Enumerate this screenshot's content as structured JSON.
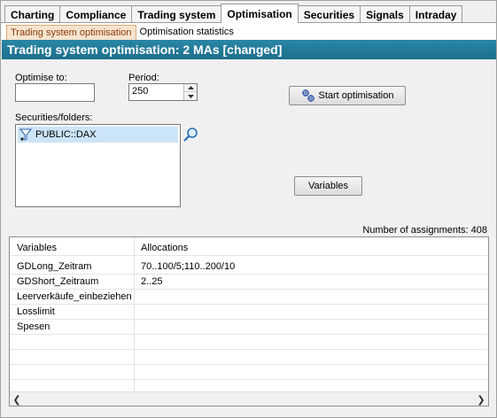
{
  "main_tabs": [
    "Charting",
    "Compliance",
    "Trading system",
    "Optimisation",
    "Securities",
    "Signals",
    "Intraday"
  ],
  "active_main_tab": "Optimisation",
  "sub_tabs": [
    "Trading system optimisation",
    "Optimisation statistics"
  ],
  "active_sub_tab": "Trading system optimisation",
  "title": "Trading system optimisation: 2 MAs [changed]",
  "form": {
    "optimise_to_label": "Optimise to:",
    "optimise_to_value": "",
    "period_label": "Period:",
    "period_value": "250",
    "securities_label": "Securities/folders:",
    "securities_items": [
      "PUBLIC::DAX"
    ],
    "start_button": "Start optimisation",
    "variables_button": "Variables"
  },
  "assignments_text": "Number of assignments: 408",
  "grid": {
    "headers": [
      "Variables",
      "Allocations"
    ],
    "rows": [
      [
        "GDLong_Zeitram",
        "70..100/5;110..200/10"
      ],
      [
        "GDShort_Zeitraum",
        "2..25"
      ],
      [
        "Leerverkäufe_einbeziehen",
        ""
      ],
      [
        "Losslimit",
        ""
      ],
      [
        "Spesen",
        ""
      ]
    ]
  },
  "colors": {
    "title_bar": "#1d6e8c",
    "sub_tab_active_bg": "#f6e4cf",
    "selection": "#cce4f7"
  }
}
